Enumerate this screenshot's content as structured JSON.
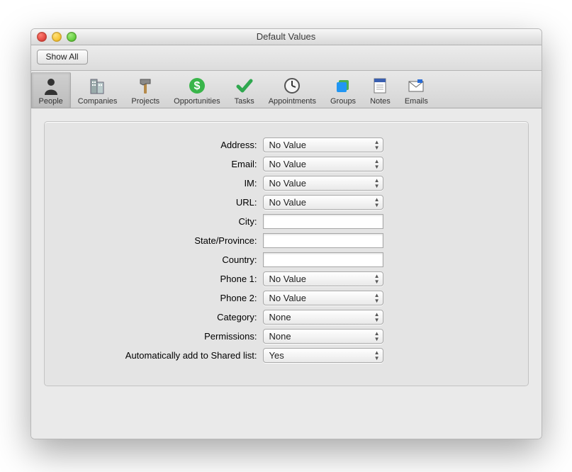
{
  "window": {
    "title": "Default Values"
  },
  "topbar": {
    "show_all": "Show All"
  },
  "tabs": [
    {
      "id": "people",
      "label": "People",
      "selected": true
    },
    {
      "id": "companies",
      "label": "Companies",
      "selected": false
    },
    {
      "id": "projects",
      "label": "Projects",
      "selected": false
    },
    {
      "id": "opportunities",
      "label": "Opportunities",
      "selected": false
    },
    {
      "id": "tasks",
      "label": "Tasks",
      "selected": false
    },
    {
      "id": "appointments",
      "label": "Appointments",
      "selected": false
    },
    {
      "id": "groups",
      "label": "Groups",
      "selected": false
    },
    {
      "id": "notes",
      "label": "Notes",
      "selected": false
    },
    {
      "id": "emails",
      "label": "Emails",
      "selected": false
    }
  ],
  "fields": {
    "address": {
      "label": "Address:",
      "type": "popup",
      "value": "No Value"
    },
    "email": {
      "label": "Email:",
      "type": "popup",
      "value": "No Value"
    },
    "im": {
      "label": "IM:",
      "type": "popup",
      "value": "No Value"
    },
    "url": {
      "label": "URL:",
      "type": "popup",
      "value": "No Value"
    },
    "city": {
      "label": "City:",
      "type": "text",
      "value": ""
    },
    "state": {
      "label": "State/Province:",
      "type": "text",
      "value": ""
    },
    "country": {
      "label": "Country:",
      "type": "text",
      "value": ""
    },
    "phone1": {
      "label": "Phone 1:",
      "type": "popup",
      "value": "No Value"
    },
    "phone2": {
      "label": "Phone 2:",
      "type": "popup",
      "value": "No Value"
    },
    "category": {
      "label": "Category:",
      "type": "popup",
      "value": "None"
    },
    "permissions": {
      "label": "Permissions:",
      "type": "popup",
      "value": "None"
    },
    "shared": {
      "label": "Automatically add to Shared list:",
      "type": "popup",
      "value": "Yes"
    }
  }
}
